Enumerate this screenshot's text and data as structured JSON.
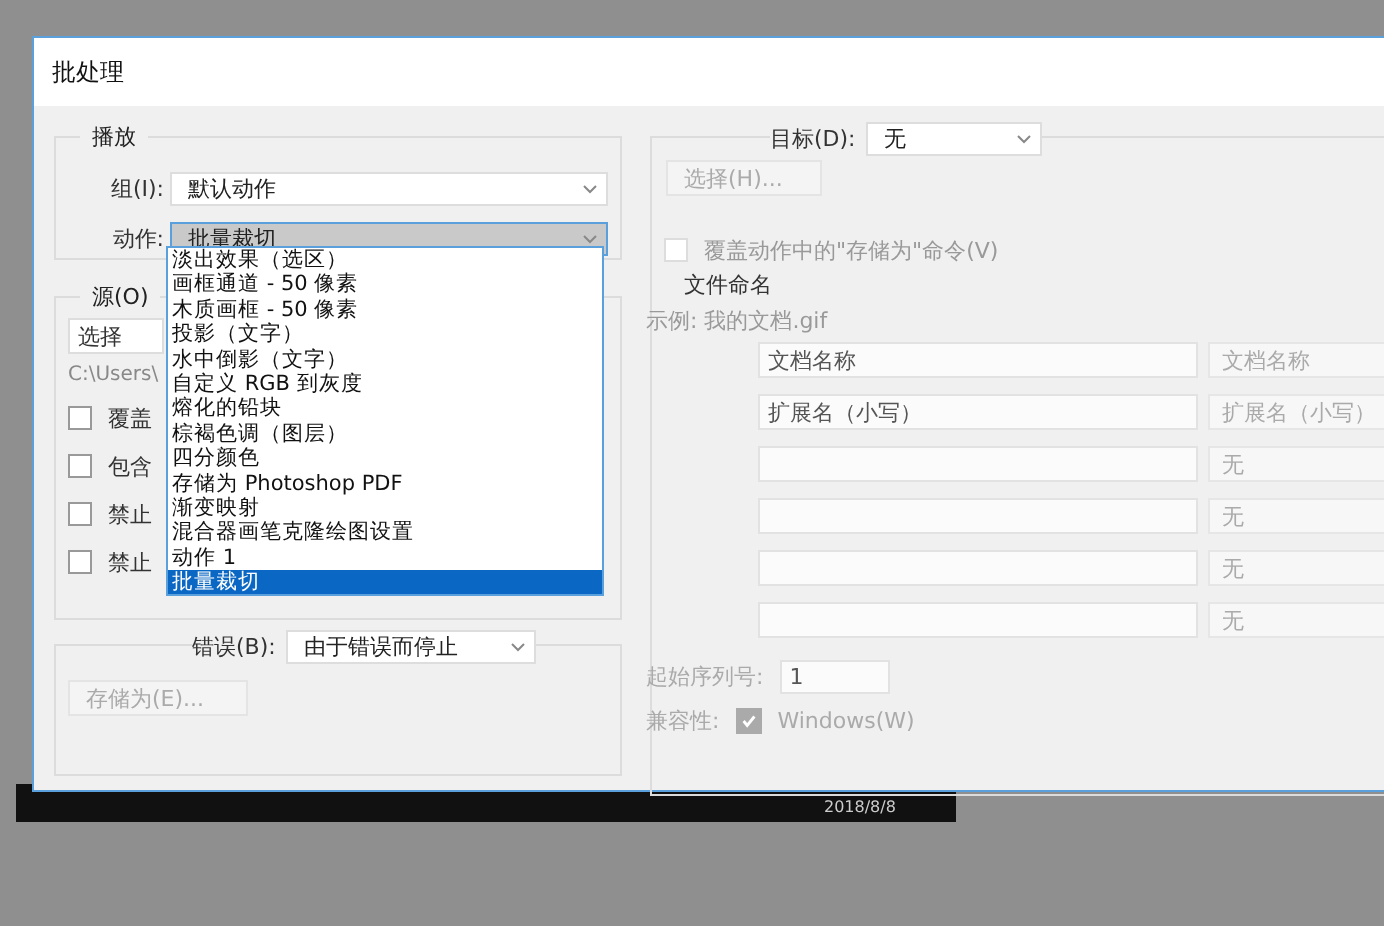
{
  "window": {
    "title": "批处理"
  },
  "play": {
    "title": "播放",
    "group_label": "组(I):",
    "group_value": "默认动作",
    "action_label": "动作:",
    "action_value": "批量裁切",
    "action_options": [
      {
        "label": "淡出效果（选区）",
        "selected": false
      },
      {
        "label": "画框通道 - 50 像素",
        "selected": false
      },
      {
        "label": "木质画框 - 50 像素",
        "selected": false
      },
      {
        "label": "投影（文字）",
        "selected": false
      },
      {
        "label": "水中倒影（文字）",
        "selected": false
      },
      {
        "label": "自定义 RGB 到灰度",
        "selected": false
      },
      {
        "label": "熔化的铅块",
        "selected": false
      },
      {
        "label": "棕褐色调（图层）",
        "selected": false
      },
      {
        "label": "四分颜色",
        "selected": false
      },
      {
        "label": "存储为 Photoshop PDF",
        "selected": false
      },
      {
        "label": "渐变映射",
        "selected": false
      },
      {
        "label": "混合器画笔克隆绘图设置",
        "selected": false
      },
      {
        "label": "动作 1",
        "selected": false
      },
      {
        "label": "批量裁切",
        "selected": true
      }
    ]
  },
  "source": {
    "title": "源(O)",
    "choose_button": "选择",
    "path": "C:\\Users\\",
    "checkboxes": [
      {
        "label": "覆盖",
        "checked": false
      },
      {
        "label": "包含",
        "checked": false
      },
      {
        "label": "禁止",
        "checked": false
      },
      {
        "label": "禁止",
        "checked": false
      }
    ]
  },
  "error": {
    "label": "错误(B):",
    "value": "由于错误而停止",
    "save_button": {
      "label": "存储为(E)...",
      "disabled": true
    }
  },
  "target": {
    "label": "目标(D):",
    "value": "无",
    "choose_button": {
      "label": "选择(H)...",
      "disabled": true
    },
    "override": {
      "label": "覆盖动作中的\"存储为\"命令(V)",
      "checked": false,
      "disabled": true
    },
    "naming": {
      "title": "文件命名",
      "example": "示例: 我的文档.gif",
      "rows": [
        {
          "value": "文档名称",
          "option": "文档名称"
        },
        {
          "value": "扩展名（小写）",
          "option": "扩展名（小写）"
        },
        {
          "value": "",
          "option": "无"
        },
        {
          "value": "",
          "option": "无"
        },
        {
          "value": "",
          "option": "无"
        },
        {
          "value": "",
          "option": "无"
        }
      ],
      "serial_label": "起始序列号:",
      "serial_value": "1",
      "compat_label": "兼容性:",
      "compat": [
        {
          "label": "Windows(W)",
          "checked": true
        }
      ]
    }
  },
  "taskbar": {
    "date": "2018/8/8"
  }
}
